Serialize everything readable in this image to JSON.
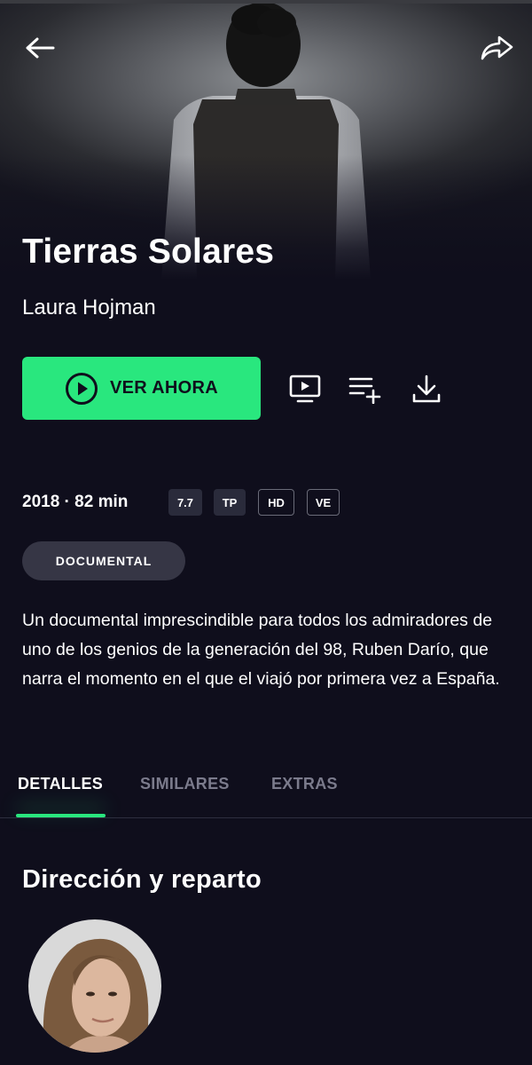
{
  "movie": {
    "title": "Tierras Solares",
    "director": "Laura Hojman",
    "meta": "2018 · 82 min",
    "badges": [
      "7.7",
      "TP",
      "HD",
      "VE"
    ],
    "genre": "DOCUMENTAL",
    "synopsis": "Un documental imprescindible para todos los admiradores de uno de los genios de la generación del 98, Ruben Darío, que narra el momento en el que el viajó por primera vez a España."
  },
  "actions": {
    "play_label": "VER AHORA",
    "icons": [
      "play-circle-icon",
      "tv-icon",
      "add-to-list-icon",
      "download-icon"
    ]
  },
  "nav": {
    "icons": [
      "back-arrow-icon",
      "share-icon"
    ]
  },
  "tabs": [
    {
      "label": "DETALLES",
      "active": true
    },
    {
      "label": "SIMILARES",
      "active": false
    },
    {
      "label": "EXTRAS",
      "active": false
    }
  ],
  "details": {
    "section_title": "Dirección y reparto"
  },
  "colors": {
    "accent": "#29e77e",
    "background": "#0f0e1c",
    "chip": "#363645",
    "inactive_tab": "#7b7b8c"
  }
}
